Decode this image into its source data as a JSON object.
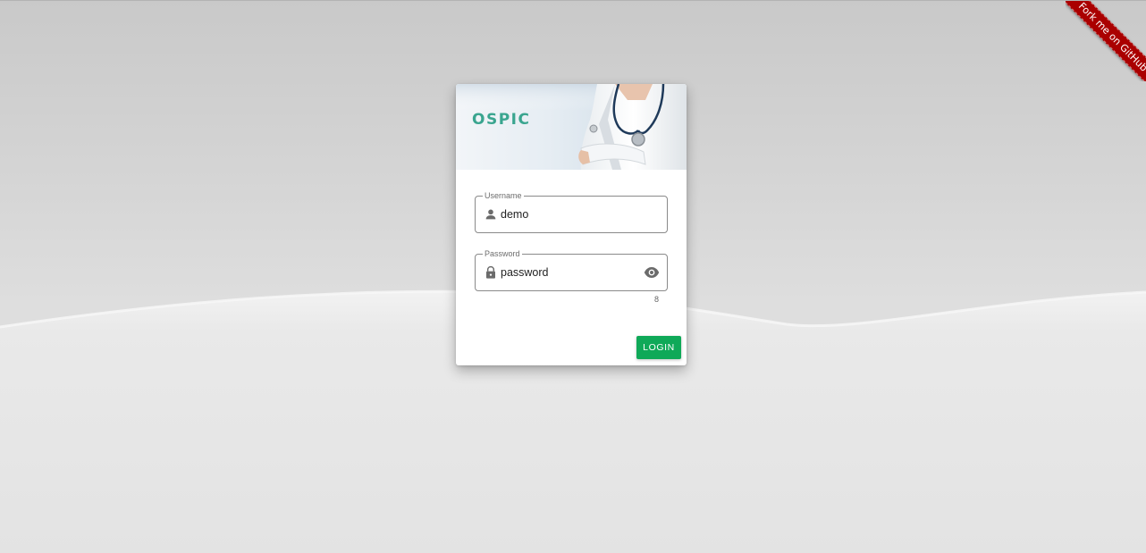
{
  "ribbon": {
    "text": "Fork me on GitHub"
  },
  "card": {
    "logo": "OSPIC",
    "username": {
      "label": "Username",
      "value": "demo",
      "icon": "person-icon"
    },
    "password": {
      "label": "Password",
      "value": "password",
      "icon": "lock-icon",
      "toggle_icon": "eye-icon",
      "char_count": "8"
    },
    "login_button": "LOGIN"
  },
  "colors": {
    "accent": "#0fa958",
    "logo": "#3aa58f",
    "ribbon": "#aa0000"
  }
}
